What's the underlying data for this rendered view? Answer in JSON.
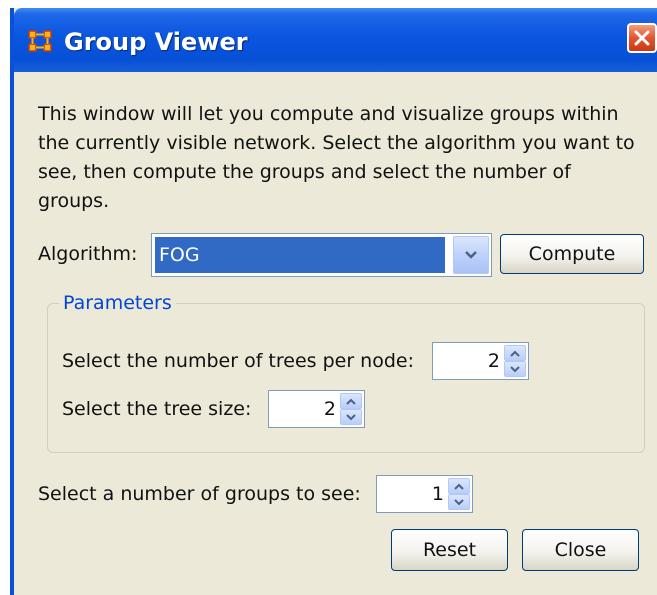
{
  "window": {
    "title": "Group Viewer",
    "icon": "network-grid-icon",
    "close_icon": "close-x-icon"
  },
  "description": "This window will let you compute and visualize groups within the currently visible network. Select the algorithm you want to see, then compute the groups and select the number of groups.",
  "algorithm": {
    "label": "Algorithm:",
    "selected": "FOG",
    "compute_label": "Compute"
  },
  "parameters": {
    "title": "Parameters",
    "trees_per_node_label": "Select the number of trees per node:",
    "trees_per_node_value": "2",
    "tree_size_label": "Select the tree size:",
    "tree_size_value": "2"
  },
  "groups": {
    "label": "Select a number of groups to see:",
    "value": "1"
  },
  "buttons": {
    "reset": "Reset",
    "close": "Close"
  },
  "colors": {
    "titlebar": "#0650d6",
    "dialog_bg": "#ece9d8",
    "selection": "#316ac5",
    "group_title": "#0046d5",
    "close_button": "#e2552e"
  }
}
